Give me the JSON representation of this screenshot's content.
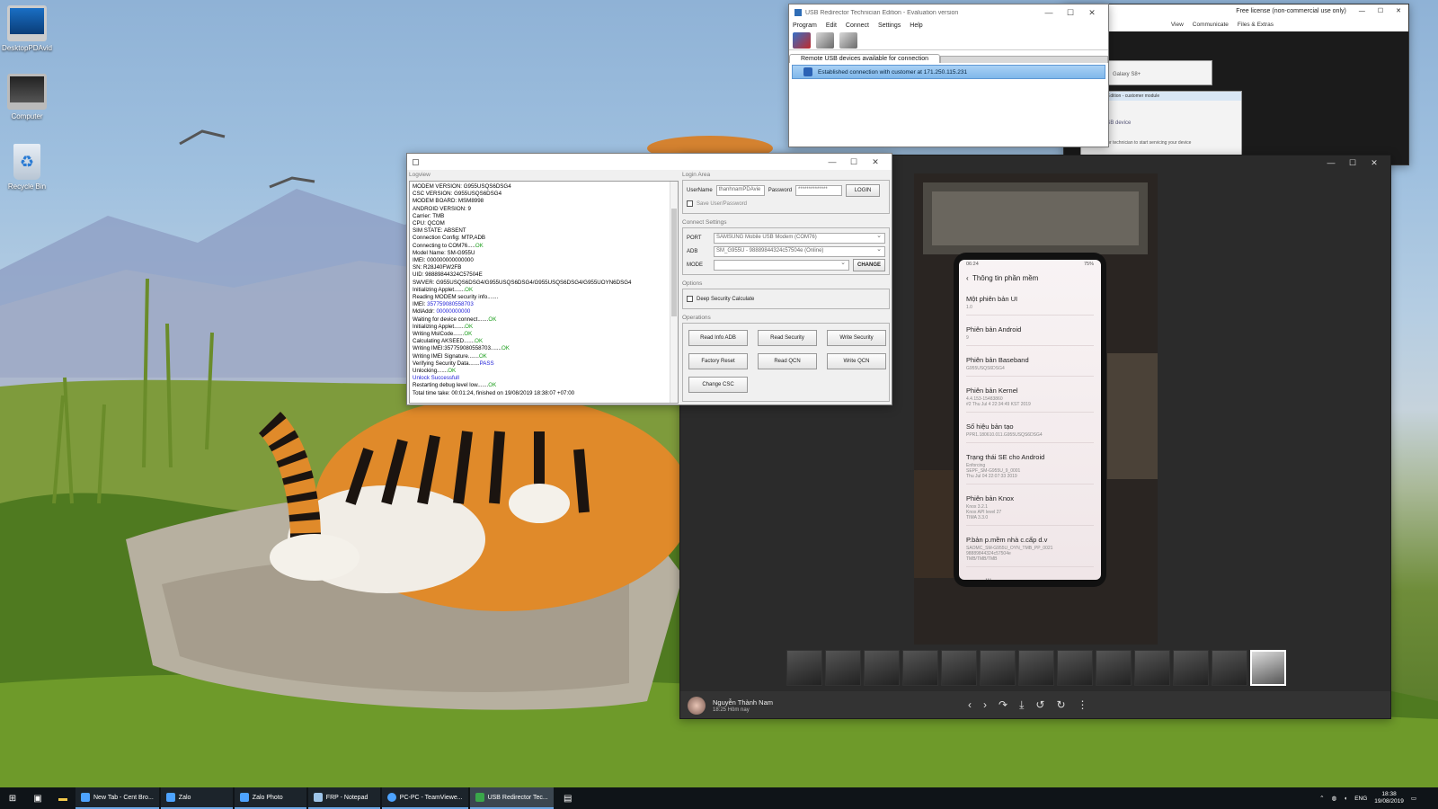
{
  "desktop": {
    "icons": [
      {
        "label": "DesktopPDAvid"
      },
      {
        "label": "Computer"
      },
      {
        "label": "Recycle Bin"
      }
    ]
  },
  "usb_redirector": {
    "title": "USB Redirector Technician Edition - Evaluation version",
    "menu": [
      "Program",
      "Edit",
      "Connect",
      "Settings",
      "Help"
    ],
    "tab": "Remote USB devices available for connection",
    "connection": "Established connection with customer at 171.250.115.231"
  },
  "teamviewer": {
    "license": "Free license (non-commercial use only)",
    "toolbar": [
      "View",
      "Communicate",
      "Files & Extras"
    ],
    "device": "Galaxy S8+",
    "customer_module": "Technician Edition - customer module",
    "usb_device": "USB device",
    "waiting": "Waiting for technician to start servicing your device"
  },
  "tool": {
    "log_group": "Logview",
    "log_lines": [
      {
        "text": "MODEM VERSION: G955USQS6DSG4",
        "status": "",
        "cls": ""
      },
      {
        "text": "CSC VERSION: G955USQS6DSG4",
        "status": "",
        "cls": ""
      },
      {
        "text": "MODEM BOARD: MSM8998",
        "status": "",
        "cls": ""
      },
      {
        "text": "ANDROID VERSION: 9",
        "status": "",
        "cls": ""
      },
      {
        "text": "Carrier: TMB",
        "status": "",
        "cls": ""
      },
      {
        "text": "CPU: QCOM",
        "status": "",
        "cls": ""
      },
      {
        "text": "SIM STATE: ABSENT",
        "status": "",
        "cls": ""
      },
      {
        "text": "Connection Config: MTP,ADB",
        "status": "",
        "cls": ""
      },
      {
        "text": "Connecting to COM76.....",
        "status": "OK",
        "cls": "ok"
      },
      {
        "text": "Model Name: SM-G955U",
        "status": "",
        "cls": ""
      },
      {
        "text": "IMEI: 000000000000000",
        "status": "",
        "cls": ""
      },
      {
        "text": "SN: R28J40FW2FB",
        "status": "",
        "cls": ""
      },
      {
        "text": "UID: 98889844324C57504E",
        "status": "",
        "cls": ""
      },
      {
        "text": "SWVER: G955USQS6DSG4/G955USQS6DSG4/G955USQS6DSG4/G955UOYN6DSG4",
        "status": "",
        "cls": ""
      },
      {
        "text": "Initializing Applet.......",
        "status": "OK",
        "cls": "ok"
      },
      {
        "text": "Reading MODEM security info.......",
        "status": "",
        "cls": ""
      },
      {
        "text": "IMEI: ",
        "status": "357759080558703",
        "cls": "blue"
      },
      {
        "text": "MdlAddr: ",
        "status": "00000000000",
        "cls": "blue"
      },
      {
        "text": "Waiting for device connect.......",
        "status": "OK",
        "cls": "ok"
      },
      {
        "text": "Initializing Applet.......",
        "status": "OK",
        "cls": "ok"
      },
      {
        "text": "Writing MslCode.......",
        "status": "OK",
        "cls": "ok"
      },
      {
        "text": "Calculating AKSEED.......",
        "status": "OK",
        "cls": "ok"
      },
      {
        "text": "Writing IMEI:357759080558703.......",
        "status": "OK",
        "cls": "ok"
      },
      {
        "text": "Writing IMEI Signature.......",
        "status": "OK",
        "cls": "ok"
      },
      {
        "text": "Verifying Security Data.......",
        "status": "PASS",
        "cls": "blue"
      },
      {
        "text": "Unlocking.......",
        "status": "OK",
        "cls": "ok"
      },
      {
        "text": "",
        "status": "Unlock Successfull",
        "cls": "blue"
      },
      {
        "text": "Restarting debug level low.......",
        "status": "OK",
        "cls": "ok"
      },
      {
        "text": "Total time take: 00:01:24, finished on 19/08/2019 18:38:07 +07:00",
        "status": "",
        "cls": ""
      }
    ],
    "login_group": "Login Area",
    "username_label": "UserName",
    "username_value": "thanhnamPDAvie",
    "password_label": "Password",
    "password_value": "**************",
    "login_button": "LOGIN",
    "save_label": "Save User/Password",
    "connect_group": "Connect Settings",
    "port_label": "PORT",
    "port_value": "SAMSUNG Mobile USB Modem (COM76)",
    "adb_label": "ADB",
    "adb_value": "SM_G955U - 98889844324c57504e (Online)",
    "mode_label": "MODE",
    "mode_value": "",
    "change_button": "CHANGE",
    "options_group": "Options",
    "deep_security": "Deep Security Calculate",
    "operations_group": "Operations",
    "operations": [
      "Read Info ADB",
      "Read Security",
      "Write Security",
      "Factory Reset",
      "Read QCN",
      "Write QCN",
      "Change CSC"
    ]
  },
  "photo": {
    "user": "Nguyễn Thành Nam",
    "time": "18:25 Hôm nay",
    "phone": {
      "status_time": "06:24",
      "battery": "75%",
      "title": "Thông tin phần mềm",
      "items": [
        {
          "k": "Một phiên bản UI",
          "v": "1.0"
        },
        {
          "k": "Phiên bản Android",
          "v": "9"
        },
        {
          "k": "Phiên bản Baseband",
          "v": "G955USQS6DSG4"
        },
        {
          "k": "Phiên bản Kernel",
          "v": "4.4.153-15483860\n#2 Thu Jul 4 22:34:49 KST 2019"
        },
        {
          "k": "Số hiệu bản tạo",
          "v": "PPR1.180610.011.G955USQS6DSG4"
        },
        {
          "k": "Trạng thái SE cho Android",
          "v": "Enforcing\nSEPF_SM-G955U_9_0001\nThu Jul 04 22:07:33 2019"
        },
        {
          "k": "Phiên bản Knox",
          "v": "Knox 3.2.1\nKnox API level 27\nTIMA 3.3.0"
        },
        {
          "k": "P.bản p.mềm nhà c.cấp d.v",
          "v": "SAOMC_SM-G955U_OYN_TMB_PP_0021\n98889844324c57504e\nTMB/TMB/TMB"
        }
      ]
    }
  },
  "taskbar": {
    "tasks": [
      "New Tab - Cent Bro...",
      "Zalo",
      "Zalo Photo",
      "FRP - Notepad",
      "PC-PC - TeamViewe...",
      "USB Redirector Tec..."
    ],
    "lang": "ENG",
    "time": "18:38",
    "date": "19/08/2019"
  }
}
